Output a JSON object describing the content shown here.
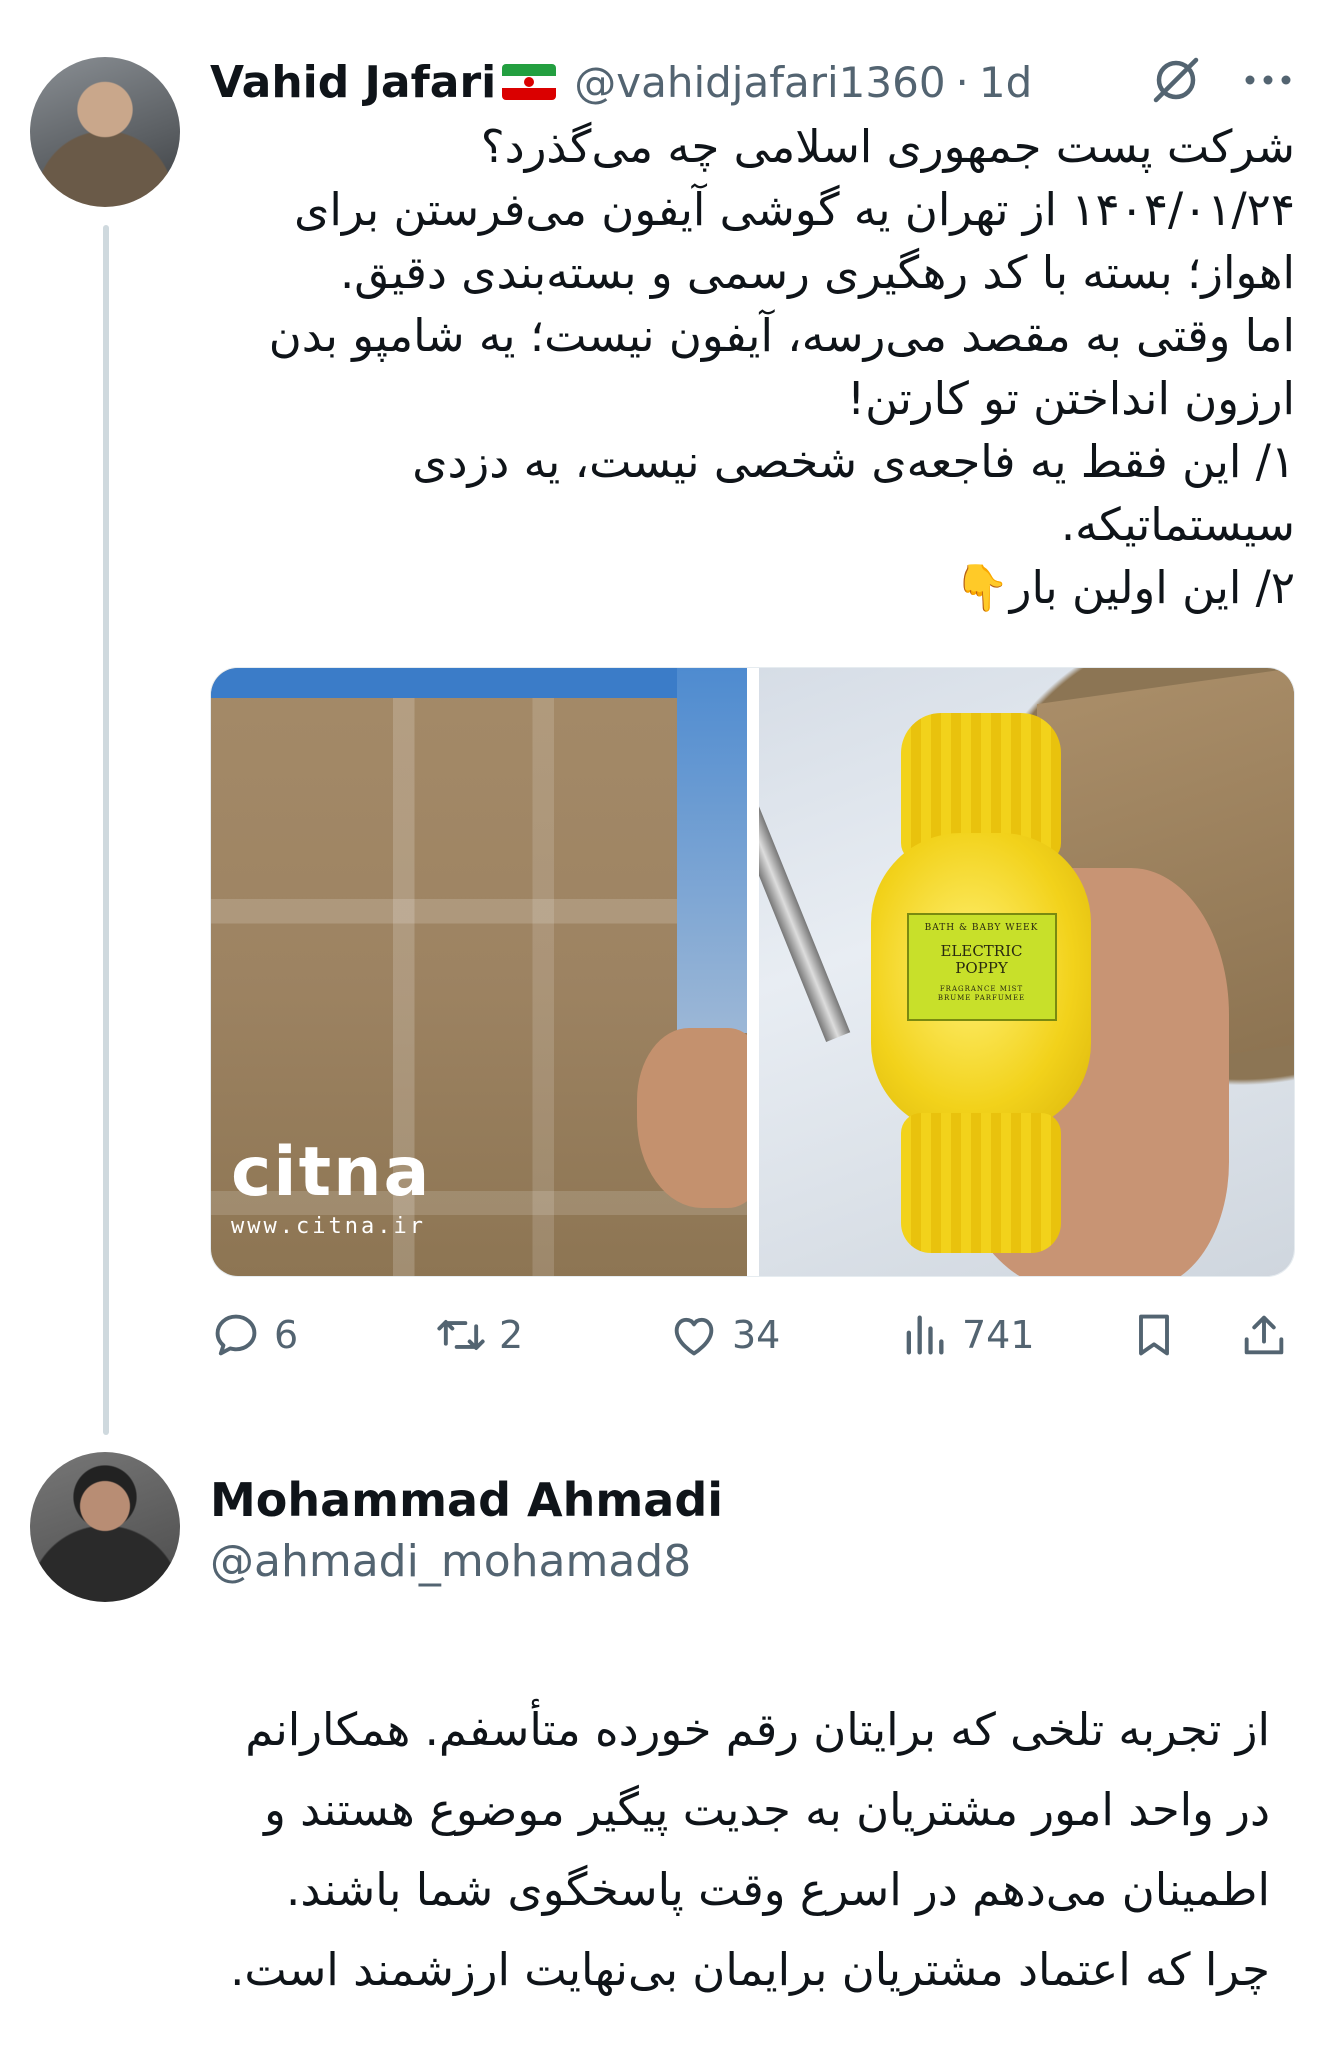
{
  "tweet": {
    "author_name": "Vahid Jafari",
    "flag_icon": "iran-flag-icon",
    "handle": "@vahidjafari1360",
    "separator": "·",
    "time": "1d",
    "text_lines": [
      "شرکت پست جمهوری اسلامی چه می‌گذرد؟",
      "۱۴۰۴/۰۱/۲۴ از تهران یه گوشی آیفون می‌فرستن برای",
      "اهواز؛ بسته با کد رهگیری رسمی و بسته‌بندی دقیق.",
      "اما وقتی به مقصد می‌رسه، آیفون نیست؛ یه شامپو بدن",
      "ارزون انداختن تو کارتن!",
      "۱/ این فقط یه فاجعه‌ی شخصی نیست، یه دزدی",
      "سیستماتیکه.",
      "۲/ این اولین بار👇"
    ],
    "media": {
      "left_watermark_logo": "citna",
      "left_watermark_url": "www.citna.ir",
      "right_label_brand": "BATH & BABY WEEK",
      "right_label_name_1": "ELECTRIC",
      "right_label_name_2": "POPPY",
      "right_label_sub_1": "FRAGRANCE MIST",
      "right_label_sub_2": "BRUME PARFUMEE"
    },
    "actions": {
      "replies": "6",
      "retweets": "2",
      "likes": "34",
      "views": "741"
    }
  },
  "reply": {
    "author_name": "Mohammad Ahmadi",
    "handle": "@ahmadi_mohamad8",
    "text_lines": [
      "از تجربه تلخی که برایتان رقم خورده متأسفم. همکارانم",
      "در واحد امور مشتریان به جدیت پیگیر موضوع هستند و",
      "اطمینان می‌دهم در اسرع وقت  پاسخگوی شما باشند.",
      "چرا که اعتماد مشتریان برایمان بی‌نهایت ارزشمند است."
    ]
  }
}
